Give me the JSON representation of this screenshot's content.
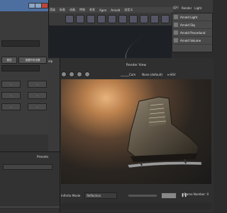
{
  "menubar": {
    "items": [
      "渲染",
      "标准",
      "动画",
      "特效",
      "毛发",
      "Xgen",
      "Arnold",
      "自定义"
    ]
  },
  "shelf": {
    "icon_names": [
      "sphere-icon",
      "cube-icon",
      "cylinder-icon",
      "light-icon",
      "camera-icon",
      "render-icon",
      "ipr-icon",
      "hypershade-icon",
      "texture-icon",
      "material-icon"
    ]
  },
  "arnold_menu": {
    "header": [
      "运行",
      "Render",
      "Light"
    ],
    "items": [
      "Arnold Light",
      "Arnold Sky",
      "Arnold Procedural",
      "Arnold Volume"
    ]
  },
  "dialog": {
    "buttons": [
      "属性",
      "重置所有设置"
    ],
    "grid": [
      [
        "…",
        "…"
      ],
      [
        "…",
        "…"
      ],
      [
        "…",
        "…"
      ]
    ]
  },
  "left_panel": {
    "menu": [
      "elp"
    ],
    "presets_label": "Presets"
  },
  "render_view": {
    "title": "Render View",
    "toolbar": {
      "camera_dropdown": "______Cam",
      "display": "None (default)",
      "color_space": "▾ HSV"
    },
    "status": {
      "mode_label": "Infinite Mode",
      "mode_value": "Reflection",
      "frame_label": "Frame Number: 0"
    }
  },
  "colors": {
    "accent": "#4c6fa0",
    "close": "#c0443a",
    "light_glow": "#e7b37d"
  }
}
